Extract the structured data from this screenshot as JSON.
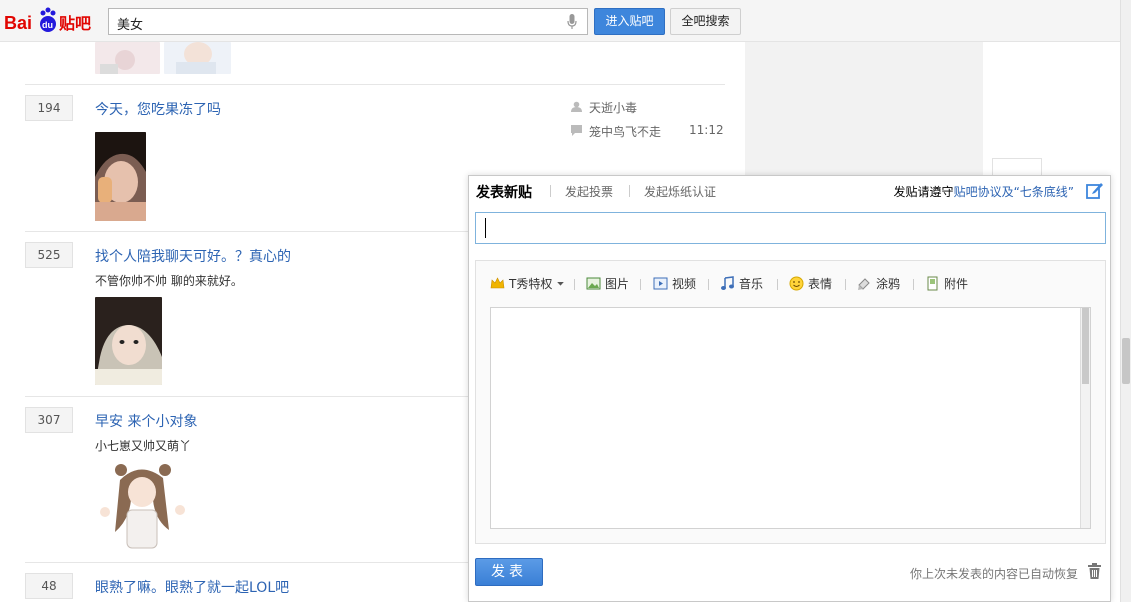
{
  "topbar": {
    "logo_text": "Baidu贴吧",
    "search_value": "美女",
    "enter_bar_button": "进入贴吧",
    "search_all_button": "全吧搜索"
  },
  "threads": [
    {
      "replies": "194",
      "title": "今天，您吃果冻了吗",
      "abstract": "",
      "author": "天逝小毒",
      "last_reply_user": "笼中鸟飞不走",
      "time": "11:12"
    },
    {
      "replies": "525",
      "title": "找个人陪我聊天可好。？真心的",
      "abstract": "不管你帅不帅 聊的来就好。"
    },
    {
      "replies": "307",
      "title": "早安 来个小对象",
      "abstract": "小七崽又帅又萌丫"
    },
    {
      "replies": "48",
      "title": "眼熟了嘛。眼熟了就一起LOL吧",
      "abstract": ""
    }
  ],
  "composer": {
    "tab_post": "发表新贴",
    "tab_vote": "发起投票",
    "tab_paper": "发起烁纸认证",
    "rules_prefix": "发贴请遵守",
    "rules_link": "贴吧协议及“七条底线”",
    "toolbar": {
      "tshow": "T秀特权",
      "image": "图片",
      "video": "视频",
      "music": "音乐",
      "emoji": "表情",
      "doodle": "涂鸦",
      "attachment": "附件"
    },
    "post_button": "发表",
    "restore_text": "你上次未发表的内容已自动恢复"
  },
  "colors": {
    "link_blue": "#2d64b3",
    "button_blue": "#3e86dc",
    "input_border": "#7fb3dd"
  }
}
